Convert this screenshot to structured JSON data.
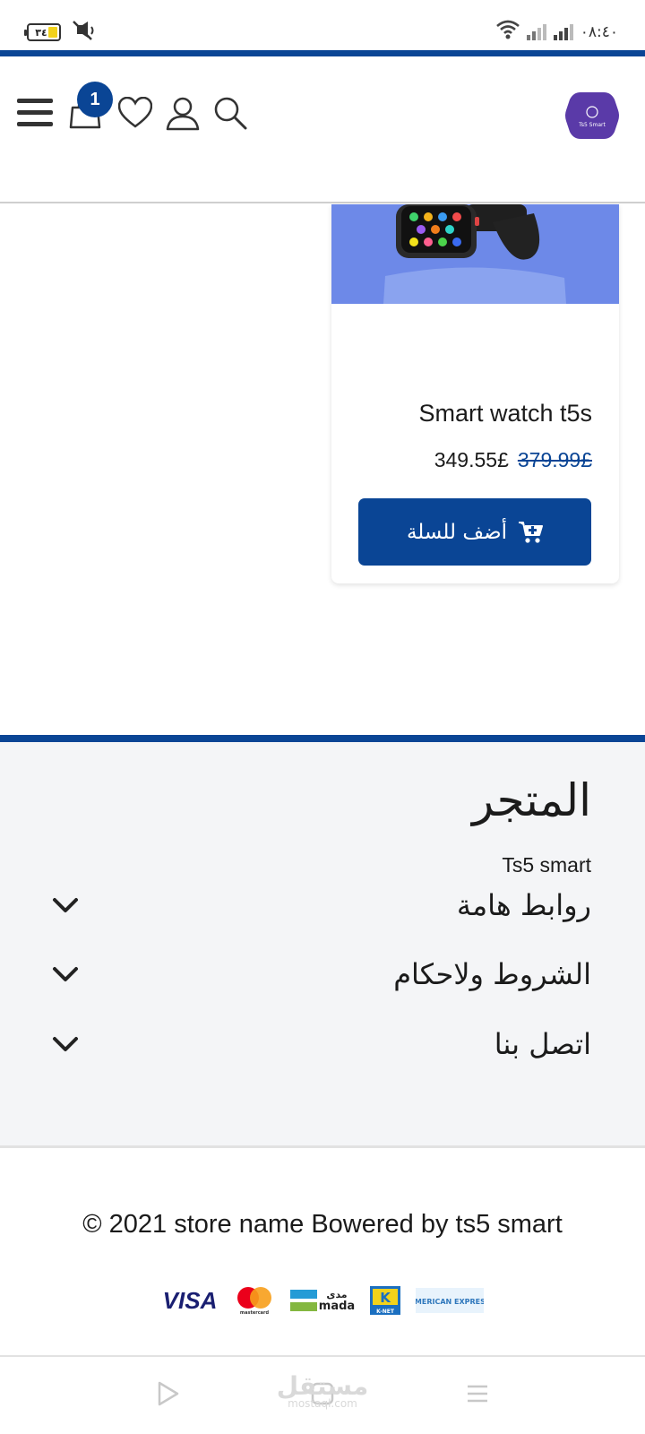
{
  "status_bar": {
    "time": "٠٨:٤٠",
    "battery": "٣٤"
  },
  "header": {
    "cart_count": "1",
    "logo_text": "Ts5 Smart"
  },
  "product": {
    "title": "Smart watch t5s",
    "price": "349.55£",
    "old_price": "379.99£",
    "add_to_cart_label": "أضف للسلة"
  },
  "footer": {
    "store_title": "المتجر",
    "store_name": "Ts5 smart",
    "sections": [
      {
        "label": "روابط هامة"
      },
      {
        "label": "الشروط ولاحكام"
      },
      {
        "label": "اتصل بنا"
      }
    ],
    "copyright": "© 2021 store name Bowered by ts5 smart",
    "payment_methods": [
      "VISA",
      "mastercard",
      "mada",
      "K-NET",
      "AMERICAN EXPRESS"
    ]
  },
  "watermark": {
    "arabic": "مستقل",
    "latin": "mostaql.com"
  },
  "colors": {
    "primary": "#0a4595",
    "logo": "#5a3aa8",
    "footer_bg": "#f4f5f7"
  }
}
